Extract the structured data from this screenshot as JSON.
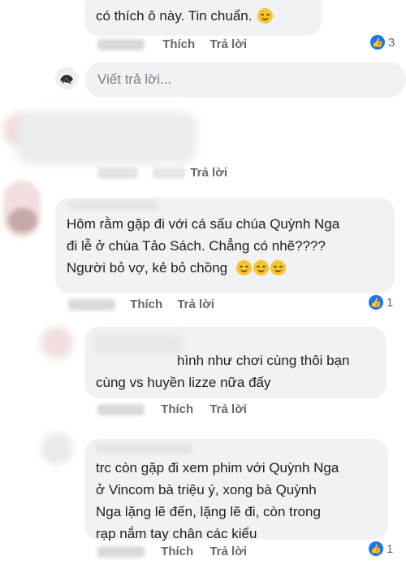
{
  "actions": {
    "like": "Thích",
    "reply": "Trả lời"
  },
  "reply_placeholder": "Viết trả lời...",
  "comments": [
    {
      "lines": [
        "có thích ô này. Tin chuẩn."
      ],
      "reaction_count": "3"
    },
    {
      "lines": [],
      "reaction_count": ""
    },
    {
      "lines": [
        "Hôm rằm gặp đi với cá sấu chúa Quỳnh Nga",
        "đi lễ ở chùa Tảo Sách. Chẳng có nhẽ????",
        "Người bỏ vợ, kẻ bỏ chồng"
      ],
      "reaction_count": "1"
    },
    {
      "lines": [
        "hình như chơi cùng thôi bạn",
        "cùng vs huyền lizze nữa đấy"
      ],
      "reaction_count": ""
    },
    {
      "lines": [
        "trc còn gặp đi xem phim với Quỳnh Nga",
        "ở Vincom bà triệu ý, xong bà Quỳnh",
        "Nga lặng lẽ đến, lặng lẽ đi, còn trong",
        "rạp nắm tay chân các kiểu"
      ],
      "reaction_count": "1"
    }
  ],
  "colors": {
    "bubble": "#f0f2f5",
    "meta_text": "#65676b",
    "like_blue": "#1877f2"
  }
}
